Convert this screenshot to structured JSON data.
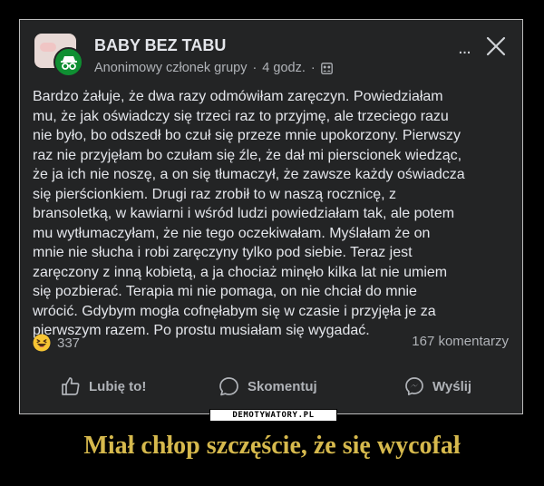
{
  "post": {
    "group_name": "BABY BEZ TABU",
    "author": "Anonimowy członek grupy",
    "separator": "·",
    "time": "4 godz.",
    "separator_2": "·",
    "more_label": "...",
    "body": "Bardzo żałuje, że dwa razy odmówiłam zaręczyn. Powiedziałam\nmu, że jak oświadczy się trzeci raz to przyjmę, ale trzeciego razu\nnie było, bo odszedł bo czuł się przeze mnie upokorzony. Pierwszy\nraz nie przyjęłam bo czułam się źle, że dał mi pierscionek wiedząc,\nże ja ich nie noszę, a on się tłumaczył, że zawsze każdy oświadcza\nsię pierścionkiem. Drugi raz zrobił to w naszą rocznicę, z\nbransoletką, w kawiarni i wśród ludzi powiedziałam tak, ale potem\nmu wytłumaczyłam, że nie tego oczekiwałam. Myślałam że on\nmnie nie słucha i robi zaręczyny tylko pod siebie. Teraz jest\nzaręczony z inną kobietą, a ja chociaż minęło kilka lat nie umiem\nsię pozbierać. Terapia mi nie pomaga, on nie chciał do mnie\nwrócić. Gdybym mogła cofnęłabym się w czasie i przyjęła je za\npierwszym razem. Po prostu musiałam się wygadać.",
    "reaction_count": "337",
    "comments_count": "167 komentarzy",
    "actions": {
      "like": "Lubię to!",
      "comment": "Skomentuj",
      "share": "Wyślij"
    }
  },
  "watermark": "DEMOTYWATORY.PL",
  "caption": "Miał chłop szczęście, że się wycofał",
  "colors": {
    "background": "#000000",
    "card": "#232425",
    "text": "#e4e6eb",
    "muted": "#b0b3b8",
    "caption": "#d6b94d",
    "anonymous_avatar": "#0f8f32"
  },
  "icons": {
    "user_avatar": "anonymous-incognito-icon",
    "privacy": "group-members-icon",
    "close": "close-icon",
    "more": "more-options-icon",
    "reaction": "laughing-emoji-icon",
    "like": "thumb-up-icon",
    "comment": "comment-bubble-icon",
    "share": "messenger-icon"
  }
}
